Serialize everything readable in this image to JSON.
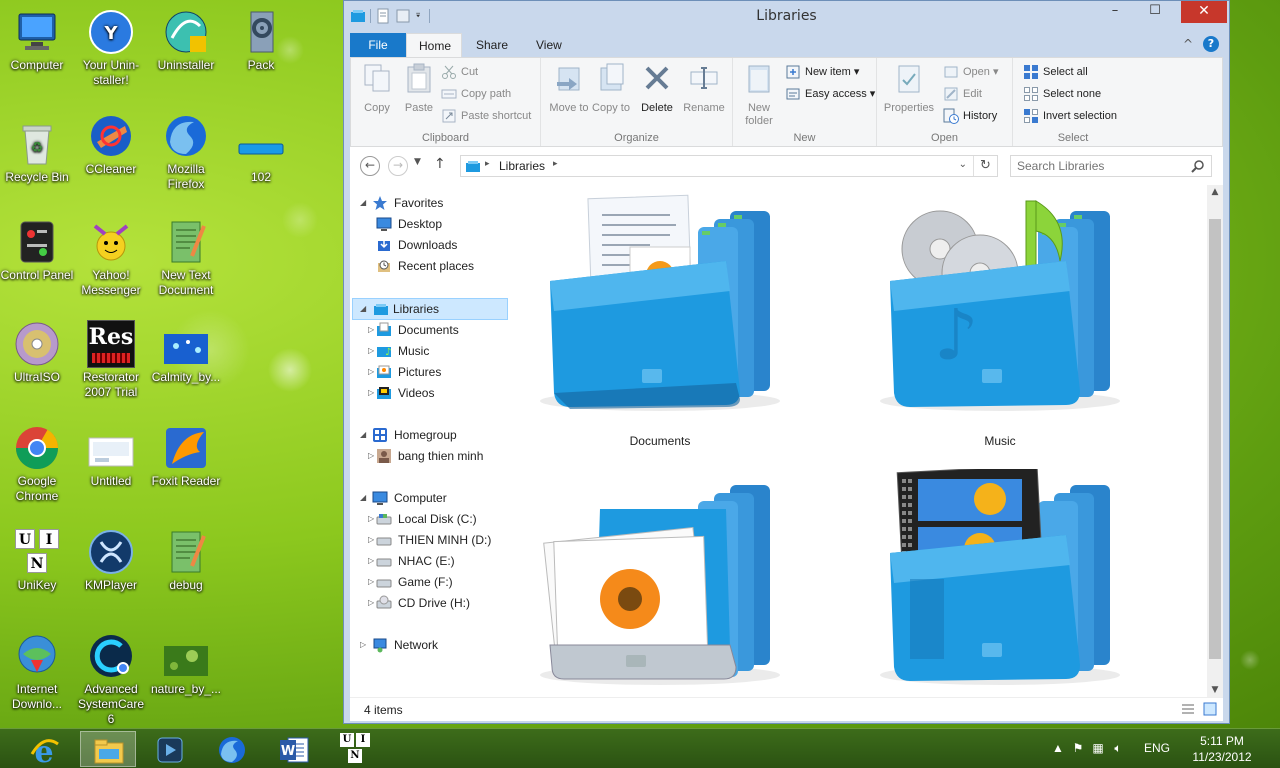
{
  "desktop": {
    "icons": [
      {
        "label": "Computer"
      },
      {
        "label": "Your Unin-staller!"
      },
      {
        "label": "Uninstaller"
      },
      {
        "label": "Pack"
      },
      {
        "label": "Recycle Bin"
      },
      {
        "label": "CCleaner"
      },
      {
        "label": "Mozilla Firefox"
      },
      {
        "label": "102"
      },
      {
        "label": "Control Panel"
      },
      {
        "label": "Yahoo! Messenger"
      },
      {
        "label": "New Text Document"
      },
      {
        "label": "UltraISO"
      },
      {
        "label": "Restorator 2007 Trial"
      },
      {
        "label": "Calmity_by..."
      },
      {
        "label": "Google Chrome"
      },
      {
        "label": "Untitled"
      },
      {
        "label": "Foxit Reader"
      },
      {
        "label": "UniKey"
      },
      {
        "label": "KMPlayer"
      },
      {
        "label": "debug"
      },
      {
        "label": "Internet Downlo..."
      },
      {
        "label": "Advanced SystemCare 6"
      },
      {
        "label": "nature_by_..."
      }
    ],
    "restorator_logo_text": "Res",
    "unikey_letters": [
      "U",
      "I",
      "N"
    ]
  },
  "window": {
    "title": "Libraries",
    "minimize": "–",
    "maximize": "☐",
    "close": "✕"
  },
  "ribbon": {
    "tabs": [
      "File",
      "Home",
      "Share",
      "View"
    ],
    "active_tab": "Home",
    "help": "?",
    "collapse": "^",
    "groups": {
      "clipboard": {
        "title": "Clipboard",
        "copy": "Copy",
        "paste": "Paste",
        "cut": "Cut",
        "copy_path": "Copy path",
        "paste_shortcut": "Paste shortcut"
      },
      "organize": {
        "title": "Organize",
        "move_to": "Move to",
        "copy_to": "Copy to",
        "delete": "Delete",
        "rename": "Rename"
      },
      "new": {
        "title": "New",
        "new_folder": "New folder",
        "new_item": "New item",
        "easy_access": "Easy access"
      },
      "open": {
        "title": "Open",
        "properties": "Properties",
        "open": "Open",
        "edit": "Edit",
        "history": "History"
      },
      "select": {
        "title": "Select",
        "select_all": "Select all",
        "select_none": "Select none",
        "invert_selection": "Invert selection"
      }
    }
  },
  "addressbar": {
    "crumbs": [
      "Libraries"
    ],
    "search_placeholder": "Search Libraries"
  },
  "nav_tree": {
    "favorites": "Favorites",
    "favorites_items": [
      "Desktop",
      "Downloads",
      "Recent places"
    ],
    "libraries": "Libraries",
    "libraries_items": [
      "Documents",
      "Music",
      "Pictures",
      "Videos"
    ],
    "homegroup": "Homegroup",
    "homegroup_items": [
      "bang thien minh"
    ],
    "computer": "Computer",
    "computer_items": [
      "Local Disk (C:)",
      "THIEN MINH (D:)",
      "NHAC (E:)",
      "Game (F:)",
      "CD Drive (H:)"
    ],
    "network": "Network"
  },
  "content": {
    "libraries": [
      {
        "name": "Documents"
      },
      {
        "name": "Music"
      },
      {
        "name": ""
      },
      {
        "name": ""
      }
    ]
  },
  "status": {
    "item_count": "4 items"
  },
  "taskbar": {
    "word_letter": "W",
    "unikey_letters": [
      "U",
      "I",
      "N"
    ],
    "tray": {
      "language": "ENG",
      "time": "5:11 PM",
      "date": "11/23/2012"
    }
  },
  "colors": {
    "accent": "#1979ca",
    "close": "#c7372b",
    "folder_blue": "#1e9ae0",
    "desktop_green": "#8cc81e"
  }
}
